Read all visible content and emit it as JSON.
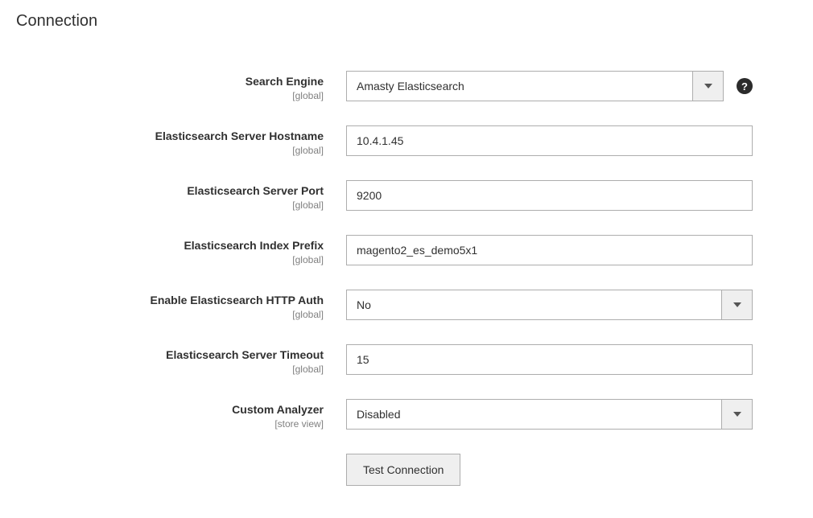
{
  "section": {
    "title": "Connection"
  },
  "fields": {
    "search_engine": {
      "label": "Search Engine",
      "scope": "[global]",
      "value": "Amasty Elasticsearch"
    },
    "hostname": {
      "label": "Elasticsearch Server Hostname",
      "scope": "[global]",
      "value": "10.4.1.45"
    },
    "port": {
      "label": "Elasticsearch Server Port",
      "scope": "[global]",
      "value": "9200"
    },
    "index_prefix": {
      "label": "Elasticsearch Index Prefix",
      "scope": "[global]",
      "value": "magento2_es_demo5x1"
    },
    "http_auth": {
      "label": "Enable Elasticsearch HTTP Auth",
      "scope": "[global]",
      "value": "No"
    },
    "timeout": {
      "label": "Elasticsearch Server Timeout",
      "scope": "[global]",
      "value": "15"
    },
    "analyzer": {
      "label": "Custom Analyzer",
      "scope": "[store view]",
      "value": "Disabled"
    }
  },
  "buttons": {
    "test": "Test Connection"
  },
  "help_icon": "?"
}
